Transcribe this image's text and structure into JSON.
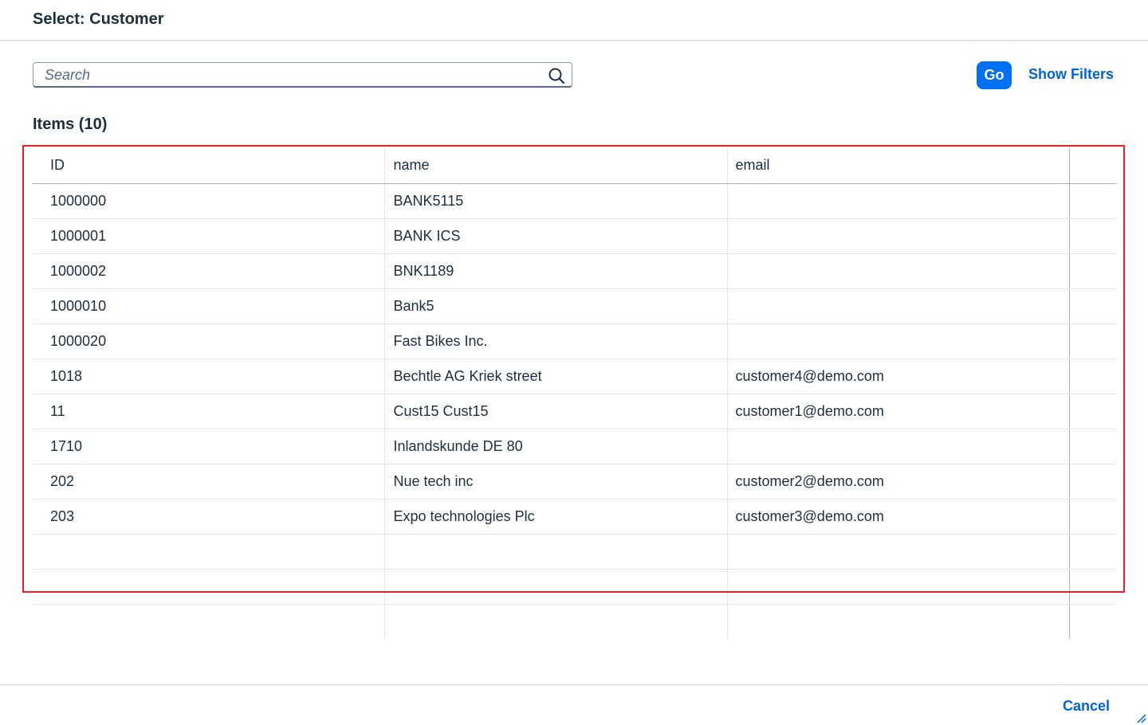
{
  "dialog": {
    "title": "Select: Customer"
  },
  "search": {
    "placeholder": "Search",
    "value": "",
    "icon": "search-icon"
  },
  "actions": {
    "go_label": "Go",
    "show_filters_label": "Show Filters",
    "accent_color": "#0070f2"
  },
  "items": {
    "title": "Items (10)"
  },
  "table": {
    "columns": [
      "ID",
      "name",
      "email"
    ],
    "rows": [
      {
        "id": "1000000",
        "name": "BANK5115",
        "email": ""
      },
      {
        "id": "1000001",
        "name": "BANK ICS",
        "email": ""
      },
      {
        "id": "1000002",
        "name": "BNK1189",
        "email": ""
      },
      {
        "id": "1000010",
        "name": "Bank5",
        "email": ""
      },
      {
        "id": "1000020",
        "name": "Fast Bikes Inc.",
        "email": ""
      },
      {
        "id": "1018",
        "name": "Bechtle AG Kriek street",
        "email": "customer4@demo.com"
      },
      {
        "id": "11",
        "name": "Cust15 Cust15",
        "email": "customer1@demo.com"
      },
      {
        "id": "1710",
        "name": "Inlandskunde DE 80",
        "email": ""
      },
      {
        "id": "202",
        "name": "Nue tech inc",
        "email": "customer2@demo.com"
      },
      {
        "id": "203",
        "name": "Expo technologies Plc",
        "email": "customer3@demo.com"
      }
    ],
    "empty_row_count": 3
  },
  "highlight": {
    "color": "#e8202a"
  },
  "footer": {
    "cancel_label": "Cancel"
  }
}
